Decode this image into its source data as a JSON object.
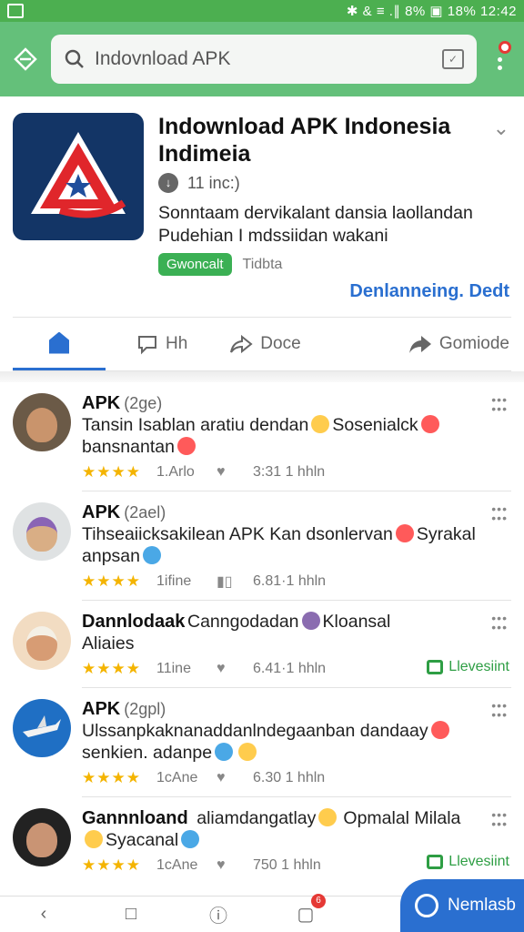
{
  "status": {
    "right": "✱ & ≡ .∥ 8% ▣ 18% 12:42"
  },
  "search": {
    "query": "Indovnload APK"
  },
  "app": {
    "title": "Indownload APK Indonesia Indimeia",
    "installs": "11 inc:)",
    "description": "Sonntaam dervikalant dansia laollandan Pudehian I mdssiidan wakani",
    "chip": "Gwoncalt",
    "tag2": "Tidbta",
    "developer": "Denlanneing. Dedt"
  },
  "tabs": [
    {
      "label": ""
    },
    {
      "label": "Hh"
    },
    {
      "label": "Doce"
    },
    {
      "label": "Gomiode"
    }
  ],
  "feed": [
    {
      "user": "APK",
      "time": "(2ge)",
      "text_a": "Tansin Isablan aratiu dendan",
      "text_b": "Sosenialck",
      "text_c": "bansnantan",
      "rating": "1.Arlo",
      "time2": "3:31 1 hhln",
      "badge": ""
    },
    {
      "user": "APK",
      "time": "(2ael)",
      "text_a": "Tihseaiicksakilean APK Kan dsonlervan",
      "text_b": "Syrakal",
      "text_c": "anpsan",
      "rating": "1ifine",
      "time2": "6.81·1 hhln",
      "badge": ""
    },
    {
      "user": "Dannlodaak",
      "time": "",
      "text_a": "Canngodadan",
      "text_b": "Kloansal",
      "text_c": "Aliaies",
      "rating": "11ine",
      "time2": "6.41·1 hhln",
      "badge": "Llevesiint"
    },
    {
      "user": "APK",
      "time": "(2gpl)",
      "text_a": "Ulssanpkaknanaddanlndegaanban dandaay",
      "text_b": "",
      "text_c": "senkien. adanpe",
      "rating": "1cAne",
      "time2": "6.30 1 hhln",
      "badge": ""
    },
    {
      "user": "Gannnloand",
      "time": "",
      "text_a": "aliamdangatlay",
      "text_b": "Opmalal Milala",
      "text_c": "Syacanal",
      "rating": "1cAne",
      "time2": "750 1 hhln",
      "badge": "Llevesiint"
    }
  ],
  "fab": {
    "label": "Nemlasb"
  },
  "bottom_badge": "6"
}
